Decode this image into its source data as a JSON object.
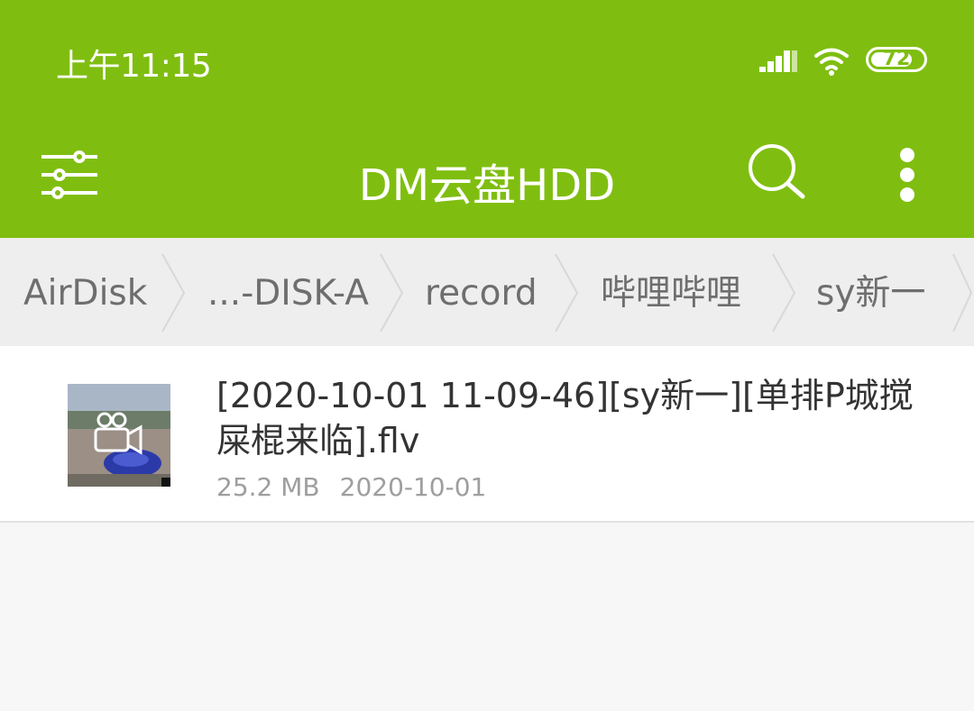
{
  "status_bar": {
    "time": "上午11:15",
    "battery_level": "72",
    "icons": [
      "signal-icon",
      "wifi-icon",
      "battery-icon"
    ]
  },
  "app_bar": {
    "title": "DM云盘HDD",
    "left_icon": "filter-menu-icon",
    "right_icons": [
      "search-icon",
      "more-vert-icon"
    ]
  },
  "breadcrumb": {
    "items": [
      "AirDisk",
      "...-DISK-A",
      "record",
      "哔哩哔哩",
      "sy新一"
    ]
  },
  "files": [
    {
      "name": "[2020-10-01 11-09-46][sy新一][单排P城搅屎棍来临].flv",
      "size": "25.2 MB",
      "date": "2020-10-01",
      "thumbnail_icon": "video-camera-icon"
    }
  ],
  "colors": {
    "primary": "#7fbe10",
    "breadcrumb_bg": "#eeeeee",
    "list_bg": "#ffffff",
    "page_bg": "#f7f7f7"
  }
}
